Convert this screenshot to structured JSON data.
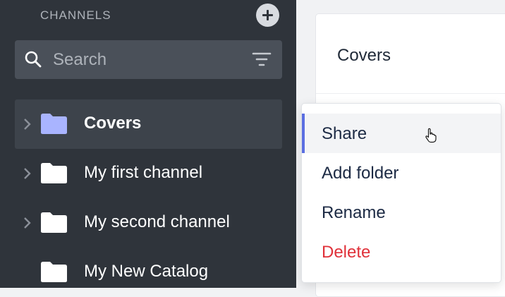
{
  "sidebar": {
    "header": "CHANNELS",
    "search": {
      "placeholder": "Search",
      "value": ""
    },
    "items": [
      {
        "label": "Covers",
        "expandable": true,
        "active": true
      },
      {
        "label": "My first channel",
        "expandable": true,
        "active": false
      },
      {
        "label": "My second channel",
        "expandable": true,
        "active": false
      },
      {
        "label": "My New Catalog",
        "expandable": false,
        "active": false
      }
    ]
  },
  "panel": {
    "title": "Covers"
  },
  "context_menu": {
    "items": [
      {
        "label": "Share",
        "hovered": true
      },
      {
        "label": "Add folder"
      },
      {
        "label": "Rename"
      },
      {
        "label": "Delete",
        "danger": true
      }
    ]
  },
  "colors": {
    "sidebar_bg": "#2f343b",
    "active_folder": "#a9b4ff",
    "accent": "#5b6ee1",
    "danger": "#e0313a"
  },
  "icons": [
    "add-icon",
    "search-icon",
    "filter-icon",
    "chevron-right-icon",
    "folder-icon",
    "pointer-cursor-icon"
  ]
}
